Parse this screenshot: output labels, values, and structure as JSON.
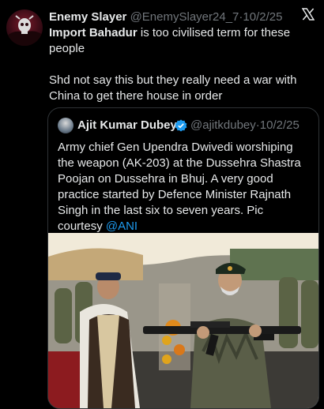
{
  "tweet": {
    "display_name": "Enemy Slayer",
    "handle": "@EnemySlayer24_7",
    "separator": "·",
    "date": "10/2/25",
    "bold_lead": "Import Bahadur",
    "text_after_bold": " is too civilised term for these people",
    "paragraph2": "Shd not say this but they really need a war with China to get there house in order",
    "avatar_icon": "skull-avatar-icon",
    "platform_icon": "x-logo-icon"
  },
  "quoted": {
    "display_name": "Ajit Kumar Dubey",
    "verified_icon": "verified-badge-icon",
    "handle": "@ajitkdubey",
    "separator": "·",
    "date": "10/2/25",
    "text": "Army chief Gen Upendra Dwivedi worshiping the weapon (AK-203) at the Dussehra Shastra Poojan on Dussehra in Bhuj. A very good practice started by Defence Minister Rajnath Singh in the last six to seven years. Pic courtesy ",
    "mention": "@ANI",
    "accent_color": "#1d9bf0"
  }
}
